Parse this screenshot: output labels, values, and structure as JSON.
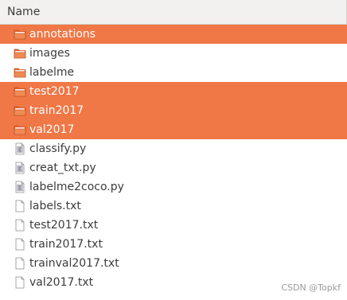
{
  "header": {
    "name_label": "Name"
  },
  "colors": {
    "selection": "#f07746",
    "folder": "#e2622a",
    "text": "#3c3c3c"
  },
  "files": [
    {
      "name": "annotations",
      "icon": "folder-icon",
      "selected": true
    },
    {
      "name": "images",
      "icon": "folder-icon",
      "selected": false
    },
    {
      "name": "labelme",
      "icon": "folder-icon",
      "selected": false
    },
    {
      "name": "test2017",
      "icon": "folder-icon",
      "selected": true
    },
    {
      "name": "train2017",
      "icon": "folder-icon",
      "selected": true
    },
    {
      "name": "val2017",
      "icon": "folder-icon",
      "selected": true
    },
    {
      "name": "classify.py",
      "icon": "python-file-icon",
      "selected": false
    },
    {
      "name": "creat_txt.py",
      "icon": "python-file-icon",
      "selected": false
    },
    {
      "name": "labelme2coco.py",
      "icon": "python-file-icon",
      "selected": false
    },
    {
      "name": "labels.txt",
      "icon": "text-file-icon",
      "selected": false
    },
    {
      "name": "test2017.txt",
      "icon": "text-file-icon",
      "selected": false
    },
    {
      "name": "train2017.txt",
      "icon": "text-file-icon",
      "selected": false
    },
    {
      "name": "trainval2017.txt",
      "icon": "text-file-icon",
      "selected": false
    },
    {
      "name": "val2017.txt",
      "icon": "text-file-icon",
      "selected": false
    }
  ],
  "watermark": "CSDN @Topkf"
}
